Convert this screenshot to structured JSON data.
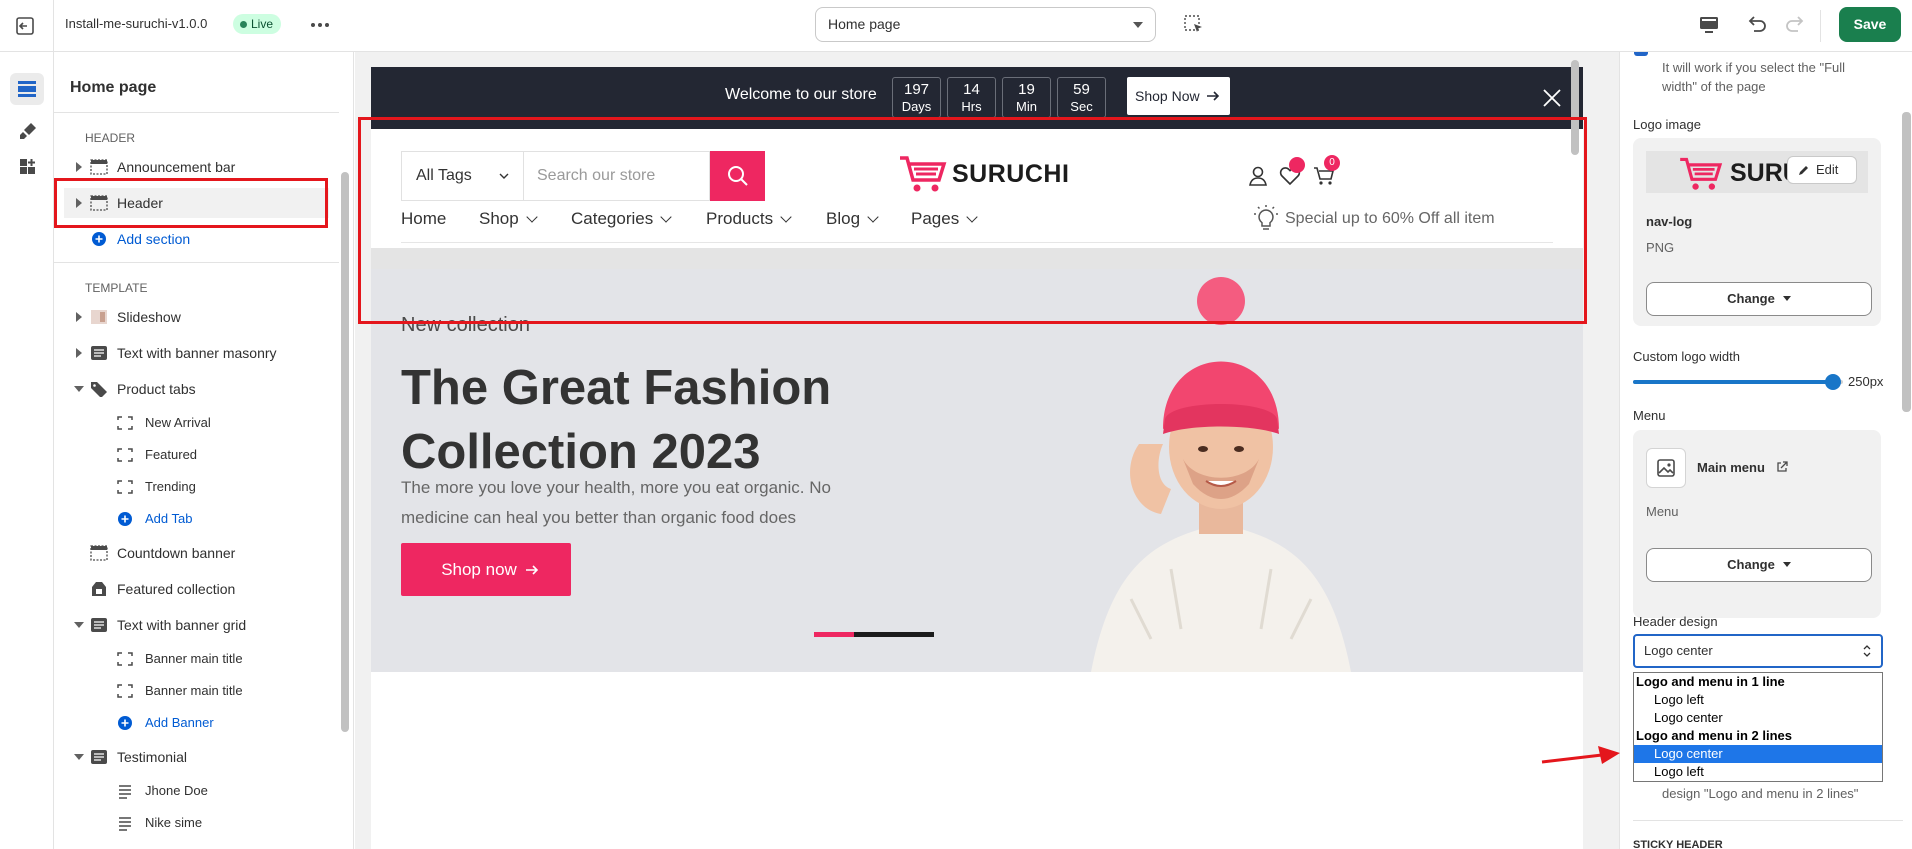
{
  "topbar": {
    "theme_name": "Install-me-suruchi-v1.0.0",
    "live_badge": "Live",
    "page_selector": "Home page",
    "save_label": "Save"
  },
  "sidebar": {
    "title": "Home page",
    "header_group": "Header",
    "template_group": "Template",
    "header_items": [
      {
        "label": "Announcement bar"
      },
      {
        "label": "Header"
      }
    ],
    "add_section": "Add section",
    "template_items": [
      {
        "label": "Slideshow"
      },
      {
        "label": "Text with banner masonry"
      },
      {
        "label": "Product tabs"
      },
      {
        "label": "New Arrival"
      },
      {
        "label": "Featured"
      },
      {
        "label": "Trending"
      },
      {
        "label": "Add Tab"
      },
      {
        "label": "Countdown banner"
      },
      {
        "label": "Featured collection"
      },
      {
        "label": "Text with banner grid"
      },
      {
        "label": "Banner main title"
      },
      {
        "label": "Banner main title"
      },
      {
        "label": "Add Banner"
      },
      {
        "label": "Testimonial"
      },
      {
        "label": "Jhone Doe"
      },
      {
        "label": "Nike sime"
      }
    ]
  },
  "preview": {
    "announcement": {
      "welcome": "Welcome to our store",
      "countdown": [
        {
          "num": "197",
          "unit": "Days"
        },
        {
          "num": "14",
          "unit": "Hrs"
        },
        {
          "num": "19",
          "unit": "Min"
        },
        {
          "num": "59",
          "unit": "Sec"
        }
      ],
      "shop_now": "Shop Now"
    },
    "header": {
      "tags_select": "All Tags",
      "search_placeholder": "Search our store",
      "logo_text": "SURUCHI",
      "cart_count": "0",
      "nav": [
        "Home",
        "Shop",
        "Categories",
        "Products",
        "Blog",
        "Pages"
      ],
      "promo": "Special up to 60% Off all item"
    },
    "hero": {
      "kicker": "New collection",
      "title": "The Great Fashion Collection 2023",
      "text": "The more you love your health, more you eat organic. No medicine can heal you better than organic food does",
      "button": "Shop now"
    },
    "colors": {
      "accent": "#ee2761",
      "dark": "#232733"
    }
  },
  "settings": {
    "full_width_note": "It will work if you select the \"Full width\" of the page",
    "logo_image_label": "Logo image",
    "logo_edit": "Edit",
    "logo_file_name": "nav-log",
    "logo_file_type": "PNG",
    "change_label": "Change",
    "custom_logo_width_label": "Custom logo width",
    "custom_logo_width_value": "250px",
    "custom_logo_width_fraction": 0.92,
    "menu_label": "Menu",
    "menu_name": "Main menu",
    "menu_sub": "Menu",
    "header_design_label": "Header design",
    "header_design_value": "Logo center",
    "header_design_options": [
      {
        "group": "Logo and menu in 1 line",
        "options": [
          "Logo left",
          "Logo center"
        ]
      },
      {
        "group": "Logo and menu in 2 lines",
        "options": [
          "Logo center",
          "Logo left"
        ]
      }
    ],
    "design_note": "design \"Logo and menu in 2 lines\"",
    "sticky_header": "STICKY HEADER",
    "colors": {
      "save": "#1a7f4e",
      "select_border": "#2165c7",
      "highlight": "#1e76e8",
      "annotation": "#e4161c"
    }
  }
}
